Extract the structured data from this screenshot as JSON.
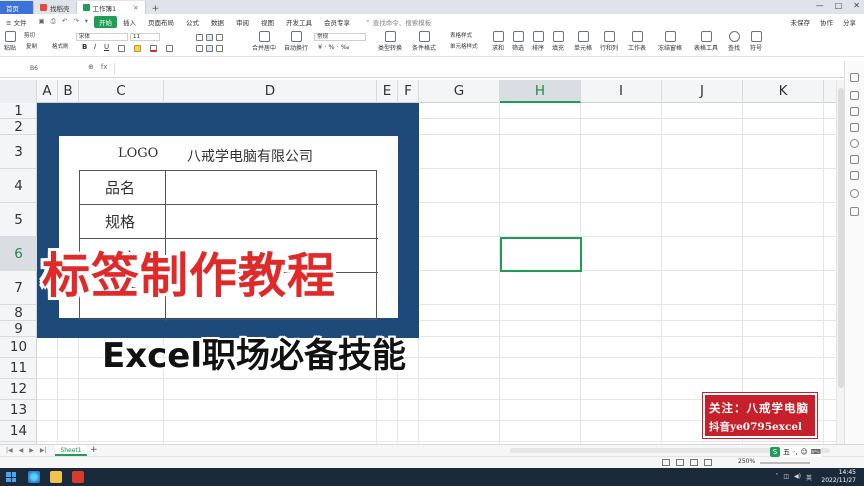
{
  "titlebar": {
    "tabs": [
      {
        "label": "首页"
      },
      {
        "label": "找稻壳"
      },
      {
        "label": "工作簿1"
      }
    ],
    "add_tab": "+",
    "controls": {
      "minimize": "—",
      "maximize": "□",
      "close": "✕"
    }
  },
  "menubar": {
    "file_label": "文件",
    "items": [
      "开始",
      "插入",
      "页面布局",
      "公式",
      "数据",
      "审阅",
      "视图",
      "开发工具",
      "会员专享"
    ],
    "search_placeholder": "查找命令、搜索模板",
    "right": [
      "未保存",
      "协作",
      "分享"
    ]
  },
  "ribbon": {
    "paste": "粘贴",
    "cut": "剪切",
    "copy": "复制",
    "format_painter": "格式刷",
    "font_name": "宋体",
    "font_size": "11",
    "merge": "合并居中",
    "wrap": "自动换行",
    "number_format": "常规",
    "type_convert": "类型转换",
    "cond_format": "条件格式",
    "table_style": "表格样式",
    "cell_style": "单元格样式",
    "sum": "求和",
    "filter": "筛选",
    "sort": "排序",
    "fill": "填充",
    "cell": "单元格",
    "rowcol": "行和列",
    "worksheet": "工作表",
    "freeze": "冻结窗格",
    "table_tools": "表格工具",
    "find": "查找",
    "symbol": "符号"
  },
  "formula_bar": {
    "name_box": "B6",
    "fx": "fx"
  },
  "grid": {
    "columns": [
      "A",
      "B",
      "C",
      "D",
      "E",
      "F",
      "G",
      "H",
      "I",
      "J",
      "K"
    ],
    "rows": [
      "1",
      "2",
      "3",
      "4",
      "5",
      "6",
      "7",
      "8",
      "9",
      "10",
      "11",
      "12",
      "13",
      "14",
      "15"
    ],
    "selected_column": "H",
    "selected_row": "6"
  },
  "label_card": {
    "logo": "LOGO",
    "company": "八戒学电脑有限公司",
    "rows": [
      "品名",
      "规格",
      "产",
      "备"
    ]
  },
  "overlay": {
    "title": "标签制作教程",
    "subtitle": "Excel职场必备技能",
    "title_color": "#e02a2a"
  },
  "stamp": {
    "line1": "关注：八戒学电脑",
    "line2": "抖音ye0795excel"
  },
  "sheet_tabs": {
    "active": "Sheet1",
    "add": "+"
  },
  "status": {
    "zoom": "250%"
  },
  "ime": {
    "label": "五"
  },
  "taskbar": {
    "time": "14:45",
    "date": "2022/11/27"
  },
  "accent_color": "#1f9d55"
}
